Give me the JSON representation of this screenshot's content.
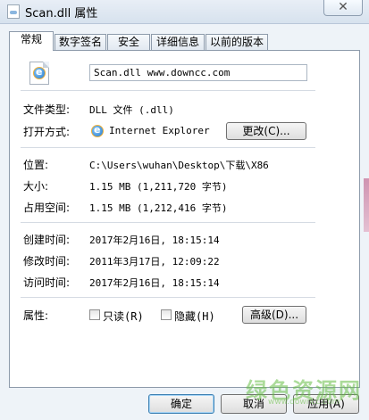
{
  "window": {
    "title": "Scan.dll 属性",
    "close": "✕"
  },
  "tabs": [
    {
      "label": "常规"
    },
    {
      "label": "数字签名"
    },
    {
      "label": "安全"
    },
    {
      "label": "详细信息"
    },
    {
      "label": "以前的版本"
    }
  ],
  "general": {
    "file_name": "Scan.dll  www.downcc.com",
    "file_type_label": "文件类型:",
    "file_type_value": "DLL 文件 (.dll)",
    "opens_with_label": "打开方式:",
    "opens_with_value": "Internet Explorer",
    "change_button": "更改(C)...",
    "location_label": "位置:",
    "location_value": "C:\\Users\\wuhan\\Desktop\\下载\\X86",
    "size_label": "大小:",
    "size_value": "1.15 MB (1,211,720 字节)",
    "size_on_disk_label": "占用空间:",
    "size_on_disk_value": "1.15 MB (1,212,416 字节)",
    "created_label": "创建时间:",
    "created_value": "2017年2月16日, 18:15:14",
    "modified_label": "修改时间:",
    "modified_value": "2011年3月17日, 12:09:22",
    "accessed_label": "访问时间:",
    "accessed_value": "2017年2月16日, 18:15:14",
    "attributes_label": "属性:",
    "readonly_label": "只读(R)",
    "hidden_label": "隐藏(H)",
    "advanced_button": "高级(D)...",
    "readonly_checked": false,
    "hidden_checked": false
  },
  "footer": {
    "ok": "确定",
    "cancel": "取消",
    "apply": "应用(A)"
  },
  "watermark": {
    "text": "绿色资源网",
    "sub": "www.downcc.com"
  },
  "icons": {
    "title": "dll-file-icon",
    "file": "ie-dll-file-icon",
    "open_with": "internet-explorer-icon"
  }
}
